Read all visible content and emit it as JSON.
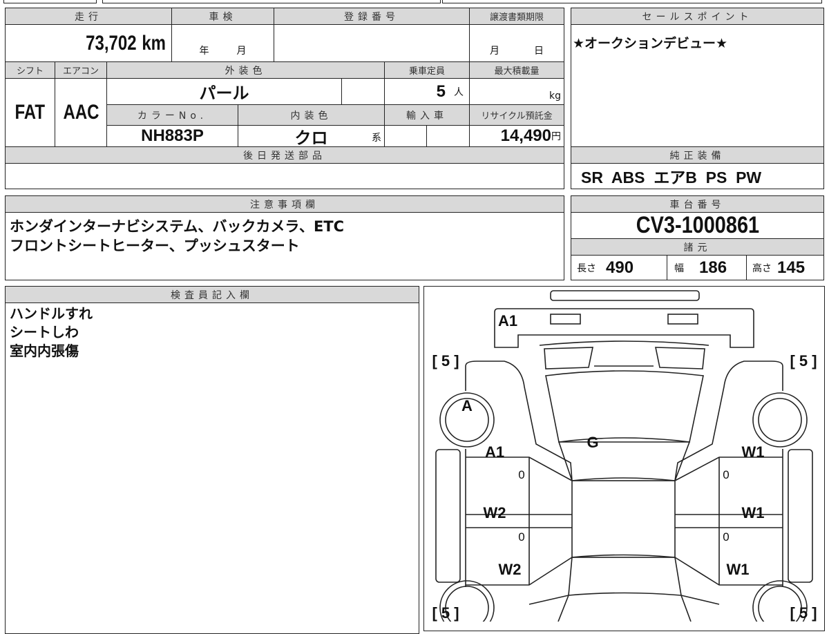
{
  "mileage": {
    "label": "走行",
    "value": "73,702",
    "unit": "km"
  },
  "inspection": {
    "label": "車検",
    "year": "年",
    "month": "月"
  },
  "registration": {
    "label": "登録番号"
  },
  "transfer_deadline": {
    "label": "譲渡書類期限",
    "month": "月",
    "day": "日"
  },
  "shift": {
    "label": "シフト",
    "value": "FAT"
  },
  "aircon": {
    "label": "エアコン",
    "value": "AAC"
  },
  "exterior_color": {
    "label": "外装色",
    "value": "パール"
  },
  "capacity": {
    "label": "乗車定員",
    "value": "5",
    "unit": "人"
  },
  "max_load": {
    "label": "最大積載量",
    "unit": "kg"
  },
  "color_no": {
    "label": "カラーNo.",
    "value": "NH883P"
  },
  "interior_color": {
    "label": "内装色",
    "value": "クロ",
    "suffix": "系"
  },
  "imported": {
    "label": "輸入車"
  },
  "recycle_fee": {
    "label": "リサイクル預託金",
    "value": "14,490",
    "unit": "円"
  },
  "later_parts": {
    "label": "後日発送部品"
  },
  "sales_point": {
    "label": "セールスポイント",
    "text": "★オークションデビュー★"
  },
  "equipment": {
    "label": "純正装備",
    "items": "SR  ABS  エアB  PS  PW"
  },
  "notes": {
    "label": "注意事項欄",
    "lines": [
      "ホンダインターナビシステム、バックカメラ、ETC",
      "フロントシートヒーター、プッシュスタート"
    ]
  },
  "chassis": {
    "label": "車台番号",
    "value": "CV3-1000861"
  },
  "specs": {
    "label": "諸元",
    "length_label": "長さ",
    "length": "490",
    "width_label": "幅",
    "width": "186",
    "height_label": "高さ",
    "height": "145"
  },
  "inspector": {
    "label": "検査員記入欄",
    "lines": [
      "ハンドルすれ",
      "シートしわ",
      "室内内張傷"
    ]
  },
  "diagram": {
    "front_bumper": "A1",
    "front_left_wheel": "A",
    "windshield": "G",
    "left_front_door": "A1",
    "left_front_door_count": "0",
    "left_rear_door": "W2",
    "left_rear_door_count": "0",
    "right_front_door": "W1",
    "right_front_door_count": "0",
    "right_rear_door": "W1",
    "right_rear_door_count": "0",
    "left_rear_fender": "W2",
    "right_rear_fender": "W1",
    "tread_fl": "[ 5 ]",
    "tread_fr": "[ 5 ]",
    "tread_rl": "[ 5 ]",
    "tread_rr": "[ 5 ]"
  }
}
